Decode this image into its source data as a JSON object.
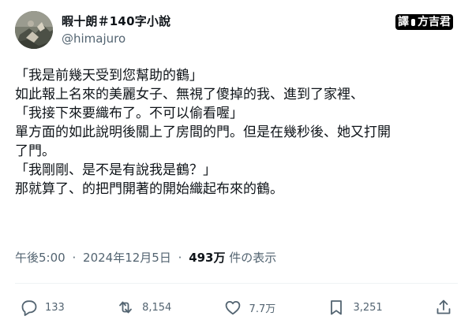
{
  "author": {
    "display_name": "暇十朗＃140字小說",
    "handle": "@himajuro"
  },
  "watermark": {
    "left": "譯",
    "right": "方吉君"
  },
  "tweet": {
    "lines": [
      "「我是前幾天受到您幫助的鶴」",
      "如此報上名來的美麗女子、無視了傻掉的我、進到了家裡、",
      "「我接下來要織布了。不可以偷看喔」",
      "單方面的如此說明後關上了房間的門。但是在幾秒後、她又打開",
      "了門。",
      "「我剛剛、是不是有說我是鶴？」",
      "那就算了、的把門開著的開始織起布來的鶴。"
    ]
  },
  "meta": {
    "time": "午後5:00",
    "separator": "·",
    "date": "2024年12月5日",
    "views_count": "493万",
    "views_label": "件の表示"
  },
  "actions": {
    "reply_count": "133",
    "repost_count": "8,154",
    "like_count": "7.7万",
    "bookmark_count": "3,251"
  },
  "colors": {
    "text": "#0f1419",
    "secondary": "#536471",
    "divider": "#eff3f4"
  },
  "icons": {
    "reply": "speech-bubble-icon",
    "repost": "repost-arrows-icon",
    "like": "heart-icon",
    "bookmark": "bookmark-icon",
    "share": "share-upload-icon"
  }
}
